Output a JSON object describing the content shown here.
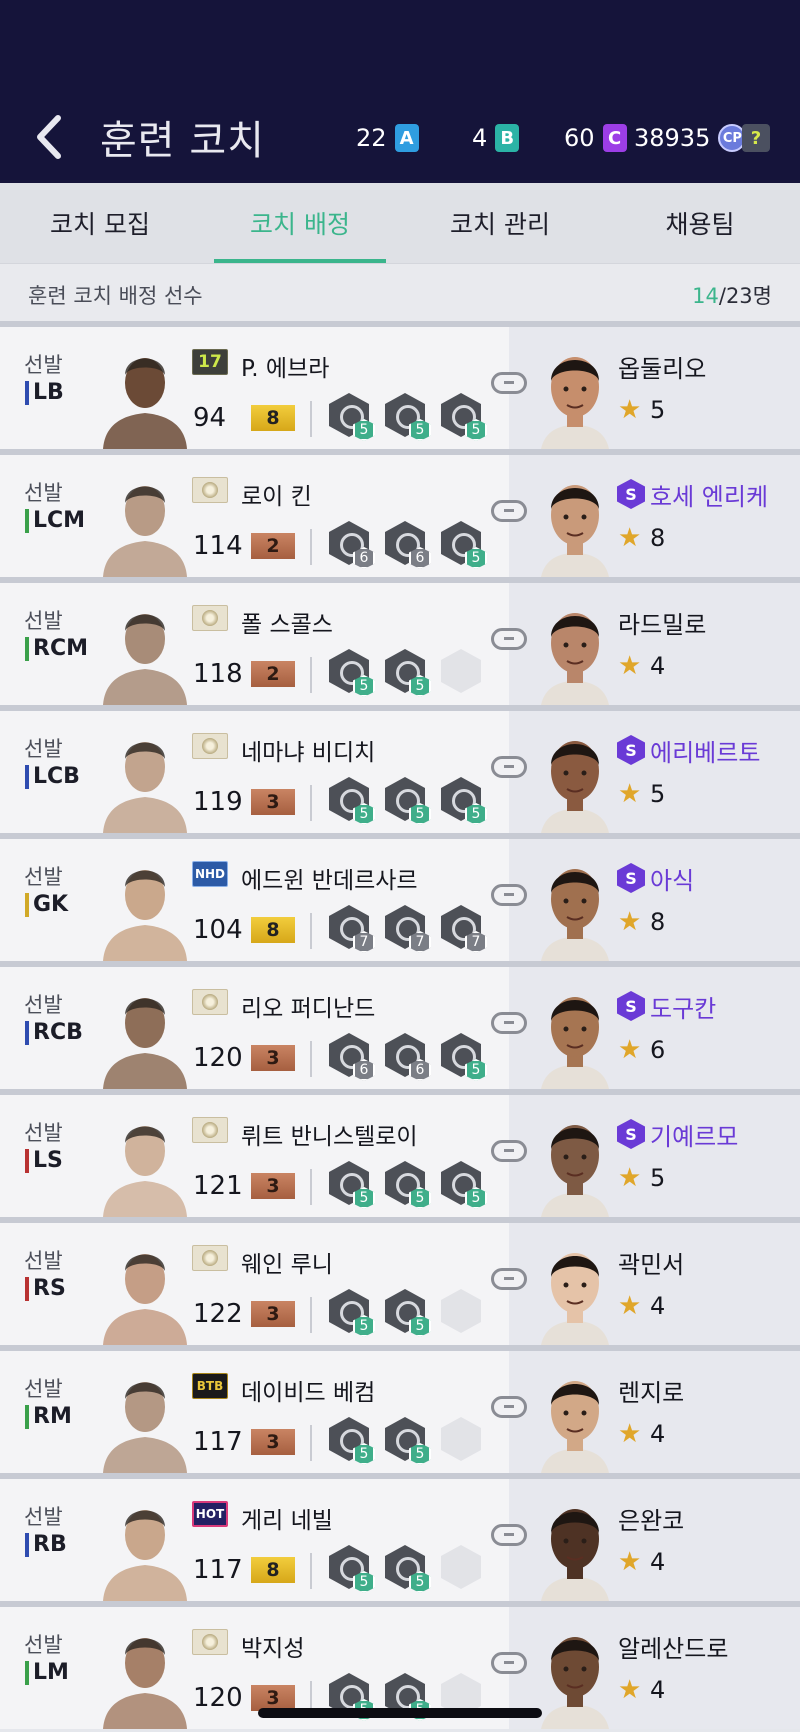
{
  "header": {
    "title": "훈련 코치",
    "currencies": [
      {
        "value": "22",
        "badge": "A",
        "color": "#2f9de0"
      },
      {
        "value": "4",
        "badge": "B",
        "color": "#2bb3a6"
      },
      {
        "value": "60",
        "badge": "C",
        "color": "#9c3ee6"
      },
      {
        "value": "38935",
        "badge": "CP",
        "color": "#6b7bdc"
      }
    ],
    "help_label": "?"
  },
  "tabs": [
    {
      "label": "코치 모집",
      "active": false
    },
    {
      "label": "코치 배정",
      "active": true
    },
    {
      "label": "코치 관리",
      "active": false
    },
    {
      "label": "채용팀",
      "active": false
    }
  ],
  "subheader": {
    "label": "훈련 코치 배정 선수",
    "assigned": "14",
    "total": "/23명"
  },
  "rows": [
    {
      "role": "선발",
      "pos": "LB",
      "posColor": "#2f4cb0",
      "season": "17",
      "seasonType": "s17",
      "name": "P. 에브라",
      "ovr": "94",
      "grade": "8",
      "gradeType": "gold",
      "skills": [
        "5",
        "5",
        "5"
      ],
      "coach": "옵둘리오",
      "special": false,
      "stars": "5"
    },
    {
      "role": "선발",
      "pos": "LCM",
      "posColor": "#3aa04a",
      "season": "",
      "seasonType": "icon",
      "name": "로이 킨",
      "ovr": "114",
      "grade": "2",
      "gradeType": "bronze",
      "skills": [
        "6",
        "6",
        "5"
      ],
      "coach": "호세 엔리케",
      "special": true,
      "stars": "8"
    },
    {
      "role": "선발",
      "pos": "RCM",
      "posColor": "#3aa04a",
      "season": "",
      "seasonType": "icon",
      "name": "폴 스콜스",
      "ovr": "118",
      "grade": "2",
      "gradeType": "bronze",
      "skills": [
        "5",
        "5",
        ""
      ],
      "coach": "라드밀로",
      "special": false,
      "stars": "4"
    },
    {
      "role": "선발",
      "pos": "LCB",
      "posColor": "#2f4cb0",
      "season": "",
      "seasonType": "icon",
      "name": "네마냐 비디치",
      "ovr": "119",
      "grade": "3",
      "gradeType": "bronze",
      "skills": [
        "5",
        "5",
        "5"
      ],
      "coach": "에리베르토",
      "special": true,
      "stars": "5"
    },
    {
      "role": "선발",
      "pos": "GK",
      "posColor": "#d1a928",
      "season": "NHD",
      "seasonType": "nhd",
      "name": "에드윈 반데르사르",
      "ovr": "104",
      "grade": "8",
      "gradeType": "gold",
      "skills": [
        "7",
        "7",
        "7"
      ],
      "coach": "아식",
      "special": true,
      "stars": "8"
    },
    {
      "role": "선발",
      "pos": "RCB",
      "posColor": "#2f4cb0",
      "season": "",
      "seasonType": "icon",
      "name": "리오 퍼디난드",
      "ovr": "120",
      "grade": "3",
      "gradeType": "bronze",
      "skills": [
        "6",
        "6",
        "5"
      ],
      "coach": "도구칸",
      "special": true,
      "stars": "6"
    },
    {
      "role": "선발",
      "pos": "LS",
      "posColor": "#b83232",
      "season": "",
      "seasonType": "icon",
      "name": "뤼트 반니스텔로이",
      "ovr": "121",
      "grade": "3",
      "gradeType": "bronze",
      "skills": [
        "5",
        "5",
        "5"
      ],
      "coach": "기예르모",
      "special": true,
      "stars": "5"
    },
    {
      "role": "선발",
      "pos": "RS",
      "posColor": "#b83232",
      "season": "",
      "seasonType": "icon",
      "name": "웨인 루니",
      "ovr": "122",
      "grade": "3",
      "gradeType": "bronze",
      "skills": [
        "5",
        "5",
        ""
      ],
      "coach": "곽민서",
      "special": false,
      "stars": "4"
    },
    {
      "role": "선발",
      "pos": "RM",
      "posColor": "#3aa04a",
      "season": "BTB",
      "seasonType": "btb",
      "name": "데이비드 베컴",
      "ovr": "117",
      "grade": "3",
      "gradeType": "bronze",
      "skills": [
        "5",
        "5",
        ""
      ],
      "coach": "렌지로",
      "special": false,
      "stars": "4"
    },
    {
      "role": "선발",
      "pos": "RB",
      "posColor": "#2f4cb0",
      "season": "HOT",
      "seasonType": "hot",
      "name": "게리 네빌",
      "ovr": "117",
      "grade": "8",
      "gradeType": "gold",
      "skills": [
        "5",
        "5",
        ""
      ],
      "coach": "은완코",
      "special": false,
      "stars": "4"
    },
    {
      "role": "선발",
      "pos": "LM",
      "posColor": "#3aa04a",
      "season": "",
      "seasonType": "icon",
      "name": "박지성",
      "ovr": "120",
      "grade": "3",
      "gradeType": "bronze",
      "skills": [
        "5",
        "5",
        ""
      ],
      "coach": "알레산드로",
      "special": false,
      "stars": "4"
    }
  ]
}
